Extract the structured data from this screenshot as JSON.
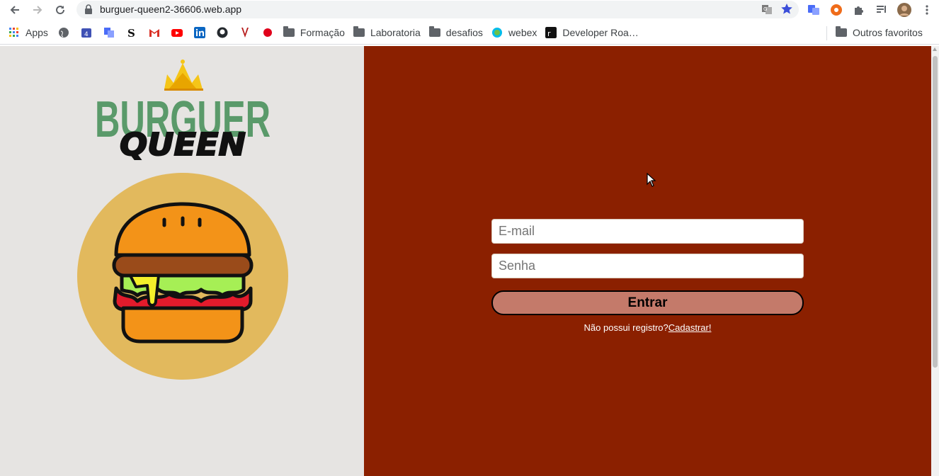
{
  "browser": {
    "url": "burguer-queen2-36606.web.app"
  },
  "bookmarks": {
    "apps_label": "Apps",
    "folders": [
      "Formação",
      "Laboratoria",
      "desafios"
    ],
    "webex_label": "webex",
    "developer_label": "Developer Roa…",
    "other_label": "Outros favoritos"
  },
  "logo": {
    "line1": "BURGUER",
    "line2": "QUEEN"
  },
  "login": {
    "email_placeholder": "E-mail",
    "password_placeholder": "Senha",
    "submit_label": "Entrar",
    "register_prompt": "Não possui registro?",
    "register_link": "Cadastrar!"
  },
  "colors": {
    "left_bg": "#e6e4e2",
    "right_bg": "#8b2000",
    "button": "#c47a6a",
    "logo_green": "#5a9a6a",
    "circle": "#e2b95d"
  }
}
